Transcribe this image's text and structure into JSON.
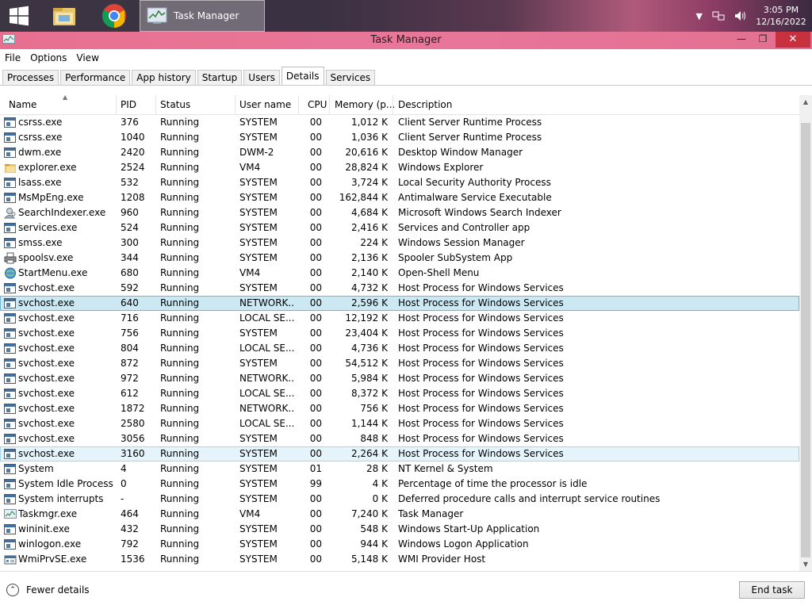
{
  "taskbar": {
    "active_window_label": "Task Manager",
    "clock_time": "3:05 PM",
    "clock_date": "12/16/2022"
  },
  "window": {
    "title": "Task Manager",
    "min_glyph": "—",
    "max_glyph": "❐",
    "close_glyph": "✕"
  },
  "menu": [
    "File",
    "Options",
    "View"
  ],
  "tabs": [
    "Processes",
    "Performance",
    "App history",
    "Startup",
    "Users",
    "Details",
    "Services"
  ],
  "active_tab": "Details",
  "columns": {
    "name": "Name",
    "pid": "PID",
    "status": "Status",
    "user": "User name",
    "cpu": "CPU",
    "memory": "Memory (p...",
    "description": "Description"
  },
  "sort_indicator": "▲",
  "processes": [
    {
      "name": "csrss.exe",
      "pid": "376",
      "status": "Running",
      "user": "SYSTEM",
      "cpu": "00",
      "mem": "1,012 K",
      "desc": "Client Server Runtime Process",
      "icon": "window-app-icon"
    },
    {
      "name": "csrss.exe",
      "pid": "1040",
      "status": "Running",
      "user": "SYSTEM",
      "cpu": "00",
      "mem": "1,036 K",
      "desc": "Client Server Runtime Process",
      "icon": "window-app-icon"
    },
    {
      "name": "dwm.exe",
      "pid": "2420",
      "status": "Running",
      "user": "DWM-2",
      "cpu": "00",
      "mem": "20,616 K",
      "desc": "Desktop Window Manager",
      "icon": "window-app-icon"
    },
    {
      "name": "explorer.exe",
      "pid": "2524",
      "status": "Running",
      "user": "VM4",
      "cpu": "00",
      "mem": "28,824 K",
      "desc": "Windows Explorer",
      "icon": "folder-icon"
    },
    {
      "name": "lsass.exe",
      "pid": "532",
      "status": "Running",
      "user": "SYSTEM",
      "cpu": "00",
      "mem": "3,724 K",
      "desc": "Local Security Authority Process",
      "icon": "window-app-icon"
    },
    {
      "name": "MsMpEng.exe",
      "pid": "1208",
      "status": "Running",
      "user": "SYSTEM",
      "cpu": "00",
      "mem": "162,844 K",
      "desc": "Antimalware Service Executable",
      "icon": "window-app-icon"
    },
    {
      "name": "SearchIndexer.exe",
      "pid": "960",
      "status": "Running",
      "user": "SYSTEM",
      "cpu": "00",
      "mem": "4,684 K",
      "desc": "Microsoft Windows Search Indexer",
      "icon": "search-person-icon"
    },
    {
      "name": "services.exe",
      "pid": "524",
      "status": "Running",
      "user": "SYSTEM",
      "cpu": "00",
      "mem": "2,416 K",
      "desc": "Services and Controller app",
      "icon": "window-app-icon"
    },
    {
      "name": "smss.exe",
      "pid": "300",
      "status": "Running",
      "user": "SYSTEM",
      "cpu": "00",
      "mem": "224 K",
      "desc": "Windows Session Manager",
      "icon": "window-app-icon"
    },
    {
      "name": "spoolsv.exe",
      "pid": "344",
      "status": "Running",
      "user": "SYSTEM",
      "cpu": "00",
      "mem": "2,136 K",
      "desc": "Spooler SubSystem App",
      "icon": "printer-icon"
    },
    {
      "name": "StartMenu.exe",
      "pid": "680",
      "status": "Running",
      "user": "VM4",
      "cpu": "00",
      "mem": "2,140 K",
      "desc": "Open-Shell Menu",
      "icon": "shell-globe-icon"
    },
    {
      "name": "svchost.exe",
      "pid": "592",
      "status": "Running",
      "user": "SYSTEM",
      "cpu": "00",
      "mem": "4,732 K",
      "desc": "Host Process for Windows Services",
      "icon": "window-app-icon"
    },
    {
      "name": "svchost.exe",
      "pid": "640",
      "status": "Running",
      "user": "NETWORK...",
      "cpu": "00",
      "mem": "2,596 K",
      "desc": "Host Process for Windows Services",
      "icon": "window-app-icon",
      "state": "selected"
    },
    {
      "name": "svchost.exe",
      "pid": "716",
      "status": "Running",
      "user": "LOCAL SE...",
      "cpu": "00",
      "mem": "12,192 K",
      "desc": "Host Process for Windows Services",
      "icon": "window-app-icon"
    },
    {
      "name": "svchost.exe",
      "pid": "756",
      "status": "Running",
      "user": "SYSTEM",
      "cpu": "00",
      "mem": "23,404 K",
      "desc": "Host Process for Windows Services",
      "icon": "window-app-icon"
    },
    {
      "name": "svchost.exe",
      "pid": "804",
      "status": "Running",
      "user": "LOCAL SE...",
      "cpu": "00",
      "mem": "4,736 K",
      "desc": "Host Process for Windows Services",
      "icon": "window-app-icon"
    },
    {
      "name": "svchost.exe",
      "pid": "872",
      "status": "Running",
      "user": "SYSTEM",
      "cpu": "00",
      "mem": "54,512 K",
      "desc": "Host Process for Windows Services",
      "icon": "window-app-icon"
    },
    {
      "name": "svchost.exe",
      "pid": "972",
      "status": "Running",
      "user": "NETWORK...",
      "cpu": "00",
      "mem": "5,984 K",
      "desc": "Host Process for Windows Services",
      "icon": "window-app-icon"
    },
    {
      "name": "svchost.exe",
      "pid": "612",
      "status": "Running",
      "user": "LOCAL SE...",
      "cpu": "00",
      "mem": "8,372 K",
      "desc": "Host Process for Windows Services",
      "icon": "window-app-icon"
    },
    {
      "name": "svchost.exe",
      "pid": "1872",
      "status": "Running",
      "user": "NETWORK...",
      "cpu": "00",
      "mem": "756 K",
      "desc": "Host Process for Windows Services",
      "icon": "window-app-icon"
    },
    {
      "name": "svchost.exe",
      "pid": "2580",
      "status": "Running",
      "user": "LOCAL SE...",
      "cpu": "00",
      "mem": "1,144 K",
      "desc": "Host Process for Windows Services",
      "icon": "window-app-icon"
    },
    {
      "name": "svchost.exe",
      "pid": "3056",
      "status": "Running",
      "user": "SYSTEM",
      "cpu": "00",
      "mem": "848 K",
      "desc": "Host Process for Windows Services",
      "icon": "window-app-icon"
    },
    {
      "name": "svchost.exe",
      "pid": "3160",
      "status": "Running",
      "user": "SYSTEM",
      "cpu": "00",
      "mem": "2,264 K",
      "desc": "Host Process for Windows Services",
      "icon": "window-app-icon",
      "state": "hover"
    },
    {
      "name": "System",
      "pid": "4",
      "status": "Running",
      "user": "SYSTEM",
      "cpu": "01",
      "mem": "28 K",
      "desc": "NT Kernel & System",
      "icon": "window-app-icon"
    },
    {
      "name": "System Idle Process",
      "pid": "0",
      "status": "Running",
      "user": "SYSTEM",
      "cpu": "99",
      "mem": "4 K",
      "desc": "Percentage of time the processor is idle",
      "icon": "window-app-icon"
    },
    {
      "name": "System interrupts",
      "pid": "-",
      "status": "Running",
      "user": "SYSTEM",
      "cpu": "00",
      "mem": "0 K",
      "desc": "Deferred procedure calls and interrupt service routines",
      "icon": "window-app-icon"
    },
    {
      "name": "Taskmgr.exe",
      "pid": "464",
      "status": "Running",
      "user": "VM4",
      "cpu": "00",
      "mem": "7,240 K",
      "desc": "Task Manager",
      "icon": "task-manager-icon"
    },
    {
      "name": "wininit.exe",
      "pid": "432",
      "status": "Running",
      "user": "SYSTEM",
      "cpu": "00",
      "mem": "548 K",
      "desc": "Windows Start-Up Application",
      "icon": "window-app-icon"
    },
    {
      "name": "winlogon.exe",
      "pid": "792",
      "status": "Running",
      "user": "SYSTEM",
      "cpu": "00",
      "mem": "944 K",
      "desc": "Windows Logon Application",
      "icon": "window-app-icon"
    },
    {
      "name": "WmiPrvSE.exe",
      "pid": "1536",
      "status": "Running",
      "user": "SYSTEM",
      "cpu": "00",
      "mem": "5,148 K",
      "desc": "WMI Provider Host",
      "icon": "wmi-icon"
    }
  ],
  "footer": {
    "fewer_details": "Fewer details",
    "end_task": "End task"
  },
  "colors": {
    "titlebar": "#e7708f",
    "selected_row": "#cce8f3",
    "close_button": "#c7303d"
  }
}
